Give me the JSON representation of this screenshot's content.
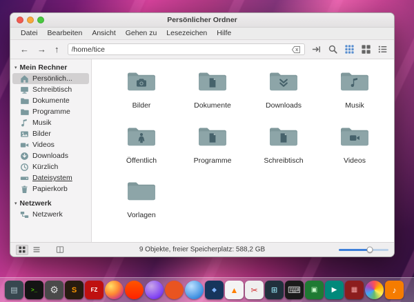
{
  "window": {
    "title": "Persönlicher Ordner",
    "traffic_lights": [
      {
        "name": "close-button",
        "color": "#f25a50"
      },
      {
        "name": "minimize-button",
        "color": "#f8a83b"
      },
      {
        "name": "maximize-button",
        "color": "#49c83f"
      }
    ],
    "menu": [
      "Datei",
      "Bearbeiten",
      "Ansicht",
      "Gehen zu",
      "Lesezeichen",
      "Hilfe"
    ],
    "toolbar": {
      "nav": [
        {
          "name": "back-button",
          "glyph": "←"
        },
        {
          "name": "forward-button",
          "glyph": "→"
        },
        {
          "name": "up-button",
          "glyph": "↑"
        }
      ],
      "path_value": "/home/tice",
      "clear_icon": "backspace",
      "icons": [
        {
          "name": "go-jump",
          "active": false
        },
        {
          "name": "search",
          "active": false
        },
        {
          "name": "icon-view",
          "active": true
        },
        {
          "name": "compact-view",
          "active": false
        },
        {
          "name": "list-view",
          "active": false
        }
      ],
      "accent_color": "#5a8fd0"
    },
    "sidebar": {
      "sections": [
        {
          "label": "Mein Rechner",
          "items": [
            {
              "label": "Persönlich...",
              "icon": "home",
              "selected": true
            },
            {
              "label": "Schreibtisch",
              "icon": "desktop"
            },
            {
              "label": "Dokumente",
              "icon": "folder"
            },
            {
              "label": "Programme",
              "icon": "folder"
            },
            {
              "label": "Musik",
              "icon": "music"
            },
            {
              "label": "Bilder",
              "icon": "image"
            },
            {
              "label": "Videos",
              "icon": "video"
            },
            {
              "label": "Downloads",
              "icon": "download"
            },
            {
              "label": "Kürzlich",
              "icon": "clock"
            },
            {
              "label": "Dateisystem",
              "icon": "drive",
              "underline": true
            },
            {
              "label": "Papierkorb",
              "icon": "trash"
            }
          ]
        },
        {
          "label": "Netzwerk",
          "items": [
            {
              "label": "Netzwerk",
              "icon": "network"
            }
          ]
        }
      ]
    },
    "folders": [
      {
        "label": "Bilder",
        "emblem": "camera"
      },
      {
        "label": "Dokumente",
        "emblem": "document"
      },
      {
        "label": "Downloads",
        "emblem": "download"
      },
      {
        "label": "Musik",
        "emblem": "music"
      },
      {
        "label": "Öffentlich",
        "emblem": "person"
      },
      {
        "label": "Programme",
        "emblem": "document"
      },
      {
        "label": "Schreibtisch",
        "emblem": "document"
      },
      {
        "label": "Videos",
        "emblem": "video-camera"
      },
      {
        "label": "Vorlagen",
        "emblem": "none"
      }
    ],
    "folder_colors": {
      "front": "#8da5a8",
      "back": "#7f989b",
      "emblem": "#46626b"
    },
    "statusbar": {
      "text": "9 Objekte, freier Speicherplatz: 588,2 GB",
      "buttons": [
        {
          "name": "icon-view-toggle",
          "icon": "grid-small",
          "pressed": true
        },
        {
          "name": "list-view-toggle",
          "icon": "lines-small",
          "pressed": false
        },
        {
          "name": "split-pane-toggle",
          "icon": "dual-pane",
          "pressed": false,
          "separated": true
        }
      ],
      "zoom_percent": 62,
      "slider_color": "#3d7fd9"
    }
  },
  "dock": {
    "apps": [
      {
        "name": "file-manager",
        "bg": "#37474f",
        "glyph": "▤",
        "fg": "#b0c4cc",
        "fs": 11
      },
      {
        "name": "terminal",
        "bg": "#141414",
        "glyph": ">_",
        "fg": "#55d400",
        "fs": 8
      },
      {
        "name": "settings",
        "bg": "#4a4a4a",
        "glyph": "⚙",
        "fg": "#dcdcdc",
        "fs": 14
      },
      {
        "name": "text-editor",
        "bg": "#271c10",
        "glyph": "S",
        "fg": "#ff9800",
        "fs": 11
      },
      {
        "name": "filezilla",
        "bg": "#bf1010",
        "glyph": "FZ",
        "fg": "#ffffff",
        "fs": 8
      },
      {
        "name": "firefox",
        "bg": "radial-gradient(circle at 32% 30%, #ffe066, #ff8833 45%, #cc3388 80%, #7733aa 100%)",
        "glyph": "",
        "round": true
      },
      {
        "name": "brave",
        "bg": "linear-gradient(180deg,#ff5500,#ff2200)",
        "glyph": "",
        "round": true
      },
      {
        "name": "purple-app",
        "bg": "radial-gradient(circle at 35% 30%, #c9a6e8, #7e3ff2 70%, #4a148c)",
        "glyph": "",
        "round": true
      },
      {
        "name": "ubuntu-app",
        "bg": "#e95420",
        "glyph": "",
        "round": true
      },
      {
        "name": "blue-app",
        "bg": "radial-gradient(circle at 35% 30%, #bde0ff, #3d8fe0 70%, #1a5fb4)",
        "glyph": "",
        "round": true
      },
      {
        "name": "navy-app",
        "bg": "#16355c",
        "glyph": "◆",
        "fg": "#7fb3ff",
        "fs": 9
      },
      {
        "name": "vlc",
        "bg": "#f4f4f4",
        "glyph": "▲",
        "fg": "#ff7f00",
        "fs": 12
      },
      {
        "name": "screenshot-tool",
        "bg": "#efefef",
        "glyph": "✂",
        "fg": "#d32f2f",
        "fs": 12
      },
      {
        "name": "calculator",
        "bg": "#20303c",
        "glyph": "⊞",
        "fg": "#8fd8e8",
        "fs": 11
      },
      {
        "name": "keyboard",
        "bg": "#1b1b1b",
        "glyph": "⌨",
        "fg": "#cccccc",
        "fs": 13
      },
      {
        "name": "green-app",
        "bg": "#1f7a33",
        "glyph": "▣",
        "fg": "#c8f7c8",
        "fs": 10
      },
      {
        "name": "media-player",
        "bg": "#00897b",
        "glyph": "▶",
        "fg": "#ffffff",
        "fs": 10
      },
      {
        "name": "red-app",
        "bg": "#8c1d1d",
        "glyph": "▦",
        "fg": "#f0a0a0",
        "fs": 10
      },
      {
        "name": "photos",
        "bg": "conic-gradient(#ff5252,#ffb300,#ffee58,#66bb6a,#42a5f5,#ab47bc,#ff5252)",
        "glyph": "",
        "round": true
      },
      {
        "name": "audio-player",
        "bg": "#f57c00",
        "glyph": "♪",
        "fg": "#ffffff",
        "fs": 12
      }
    ]
  }
}
